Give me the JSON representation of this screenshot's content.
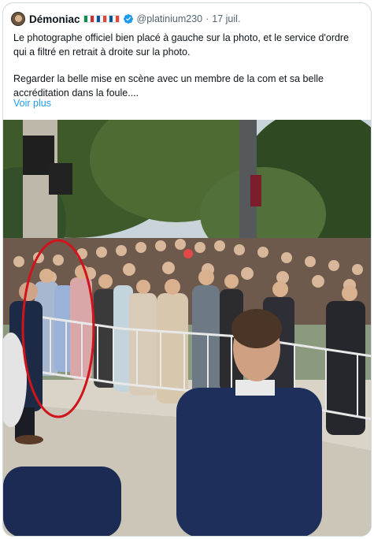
{
  "tweet": {
    "author_name": "Démoniac",
    "handle": "@platinium230",
    "separator": "·",
    "date": "17 juil.",
    "text_paragraph_1": "Le photographe officiel bien placé à gauche sur la photo, et le service d'ordre qui a filtré en retrait à droite sur la photo.",
    "text_paragraph_2": "Regarder la belle mise en scène avec un membre de la com et sa belle accréditation dans la foule....",
    "show_more_label": "Voir plus"
  },
  "icons": {
    "avatar": "avatar-icon",
    "flag_italy": "italy-flag-icon",
    "flag_france": "france-flag-icon",
    "verified": "verified-badge-icon"
  },
  "colors": {
    "link": "#1d9bf0",
    "secondary_text": "#536471",
    "verified_badge": "#1d9bf0",
    "annotation_circle": "#d0141c"
  }
}
